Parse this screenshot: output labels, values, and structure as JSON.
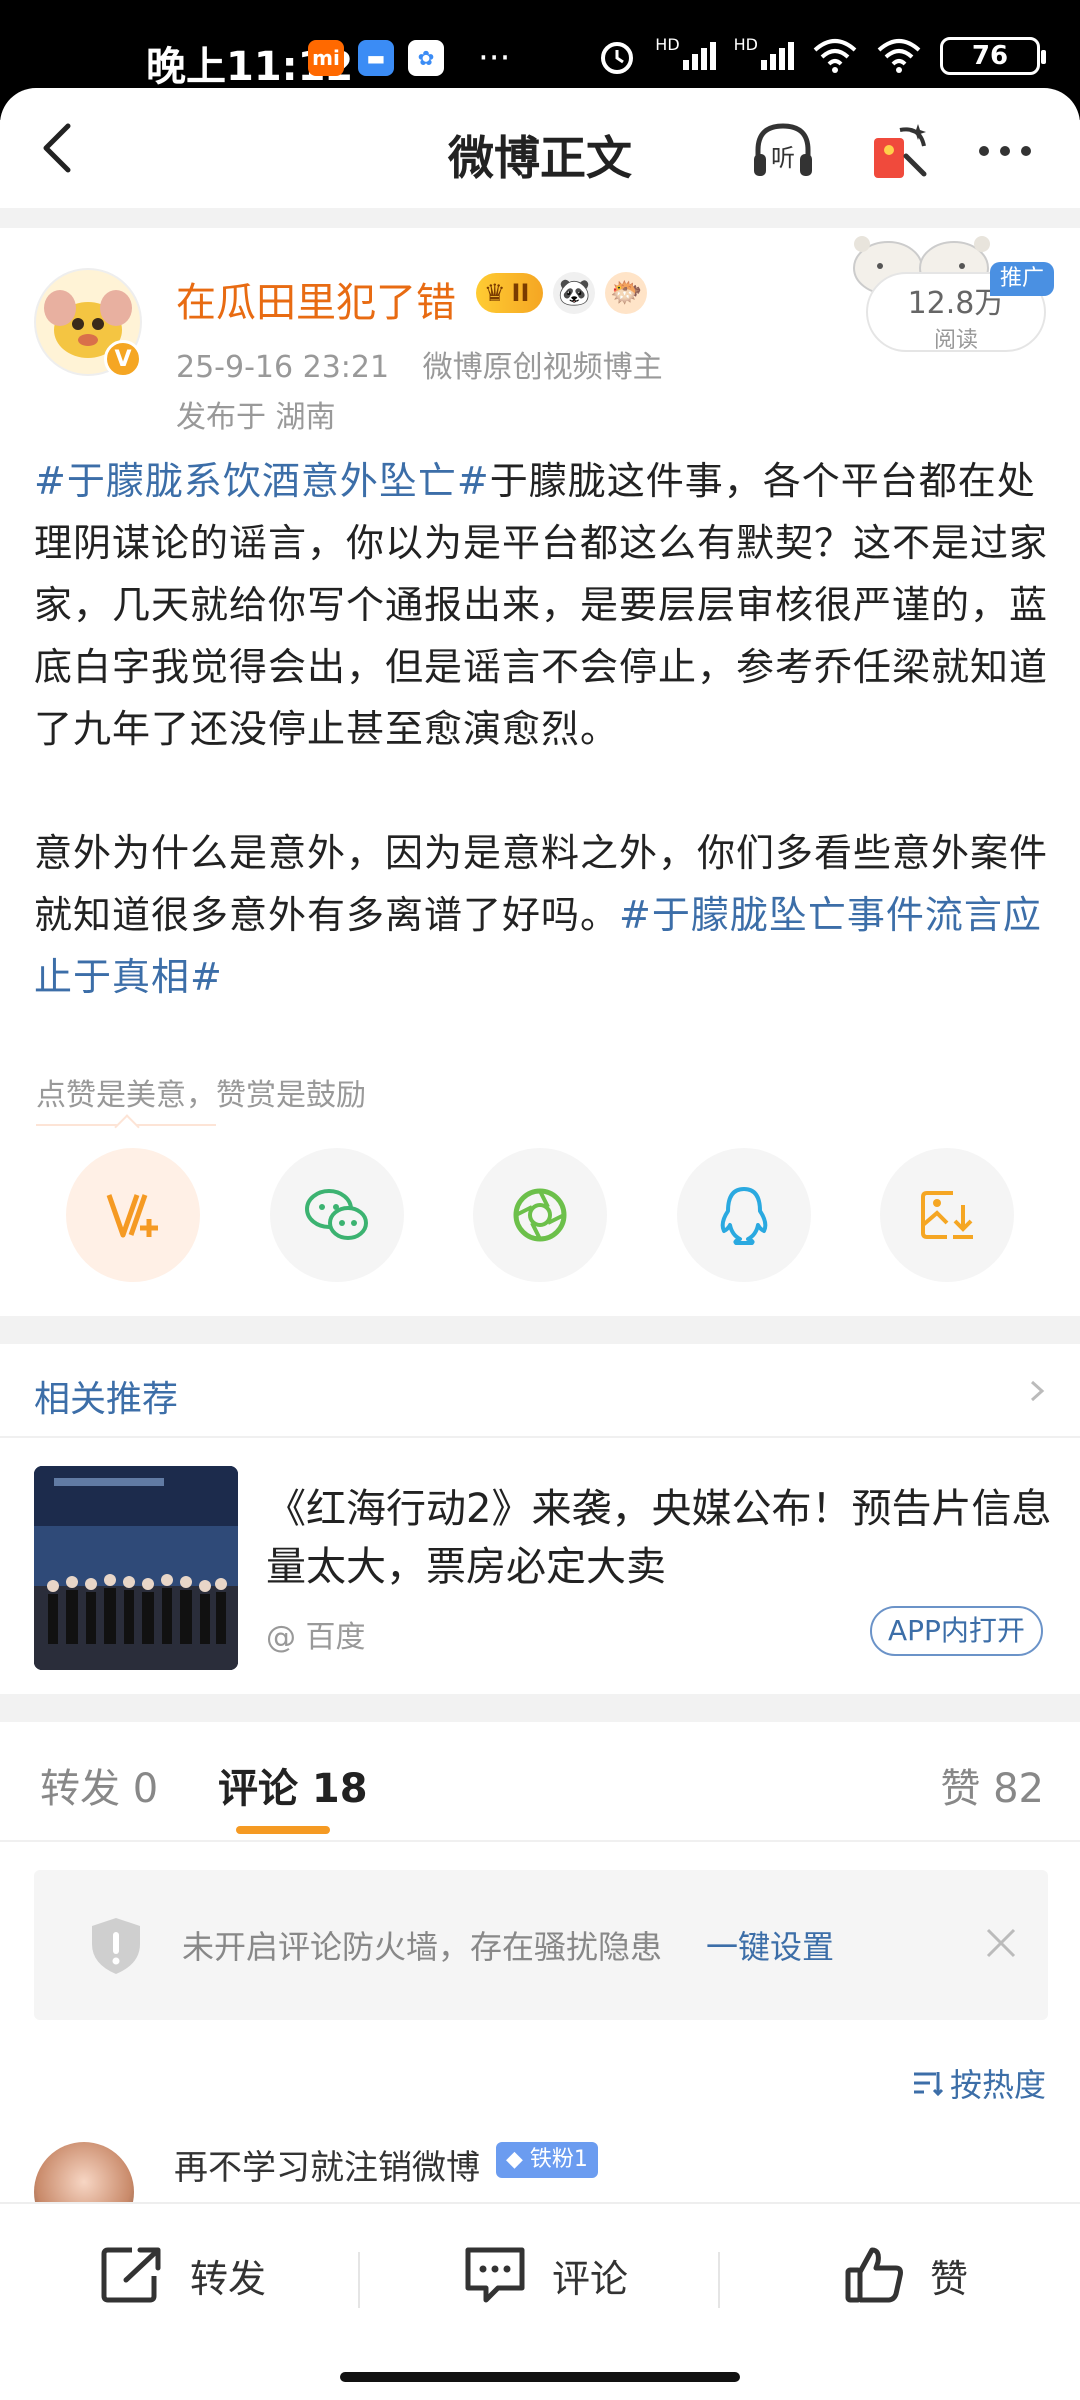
{
  "status_bar": {
    "time": "晚上11:12",
    "battery": "76",
    "hd1": "HD",
    "hd2": "HD"
  },
  "header": {
    "title": "微博正文",
    "listen_label": "听"
  },
  "post": {
    "author": "在瓜田里犯了错",
    "vip_level": "II",
    "verified_mark": "V",
    "date": "25-9-16 23:21",
    "author_role": "微博原创视频博主",
    "location": "发布于 湖南",
    "reads_count": "12.8万",
    "reads_label": "阅读",
    "promo_tag": "推广",
    "paragraph1": {
      "topic": "#于朦胧系饮酒意外坠亡#",
      "text": "于朦胧这件事，各个平台都在处理阴谋论的谣言，你以为是平台都这么有默契？这不是过家家，几天就给你写个通报出来，是要层层审核很严谨的，蓝底白字我觉得会出，但是谣言不会停止，参考乔任梁就知道了九年了还没停止甚至愈演愈烈。"
    },
    "paragraph2": {
      "text": "意外为什么是意外，因为是意料之外，你们多看些意外案件就知道很多意外有多离谱了好吗。",
      "topic": "#于朦胧坠亡事件流言应止于真相#"
    },
    "reward_tip": "点赞是美意，赞赏是鼓励",
    "share_icons": [
      "reward-icon",
      "wechat-icon",
      "moments-icon",
      "qq-icon",
      "save-image-icon"
    ]
  },
  "related": {
    "title": "相关推荐",
    "headline": "《红海行动2》来袭，央媒公布！预告片信息量太大，票房必定大卖",
    "source": "@ 百度",
    "open_app": "APP内打开"
  },
  "comments": {
    "tabs": {
      "repost": "转发 0",
      "comment": "评论 18",
      "like": "赞 82"
    },
    "firewall_text": "未开启评论防火墙，存在骚扰隐患",
    "firewall_link": "一键设置",
    "sort_label": "按热度",
    "first_comment": {
      "user": "再不学习就注销微博",
      "fan_badge": "铁粉1"
    }
  },
  "bottom_bar": {
    "repost": "转发",
    "comment": "评论",
    "like": "赞"
  },
  "colors": {
    "accent_orange": "#f59a23",
    "link_blue": "#3c6ea8",
    "author_orange": "#e86b12"
  }
}
